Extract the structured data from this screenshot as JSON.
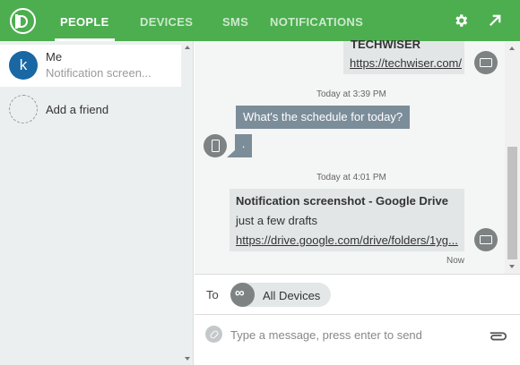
{
  "header": {
    "tabs": [
      {
        "label": "PEOPLE",
        "active": true
      },
      {
        "label": "DEVICES",
        "active": false
      },
      {
        "label": "SMS",
        "active": false
      },
      {
        "label": "NOTIFICATIONS",
        "active": false
      }
    ],
    "icons": [
      "pushbullet-logo-icon",
      "gear-icon",
      "popout-arrow-icon"
    ],
    "color": "#4cae4f"
  },
  "sidebar": {
    "contacts": [
      {
        "avatar_letter": "k",
        "name": "Me",
        "preview": "Notification screen..."
      }
    ],
    "add_friend_label": "Add a friend"
  },
  "chat": {
    "messages": [
      {
        "title": "TECHWISER",
        "link": "https://techwiser.com/",
        "device": "monitor-icon"
      },
      {
        "timestamp": "Today at 3:39 PM"
      },
      {
        "text": "What's the schedule for today?"
      },
      {
        "text": ".",
        "device": "phone-icon"
      },
      {
        "timestamp": "Today at 4:01 PM"
      },
      {
        "title": "Notification screenshot - Google Drive",
        "body": "just a few drafts",
        "link": "https://drive.google.com/drive/folders/1yg...",
        "device": "monitor-icon",
        "status": "Now"
      }
    ]
  },
  "recipient": {
    "label": "To",
    "chip_label": "All Devices",
    "chip_icon": "infinity-icon"
  },
  "composer": {
    "placeholder": "Type a message, press enter to send",
    "icons": [
      "link-icon",
      "paperclip-icon"
    ]
  }
}
